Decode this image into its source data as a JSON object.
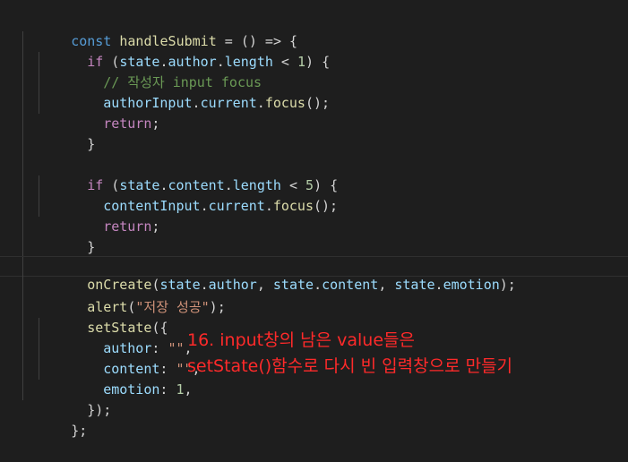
{
  "code": {
    "l1": [
      "const",
      " ",
      "handleSubmit",
      " = () => {"
    ],
    "l2": [
      "if",
      " (",
      "state",
      ".",
      "author",
      ".",
      "length",
      " < ",
      "1",
      ") {"
    ],
    "l3": [
      "// 작성자 input focus"
    ],
    "l4": [
      "authorInput",
      ".",
      "current",
      ".",
      "focus",
      "();"
    ],
    "l5": [
      "return",
      ";"
    ],
    "l6": [
      "}"
    ],
    "l8": [
      "if",
      " (",
      "state",
      ".",
      "content",
      ".",
      "length",
      " < ",
      "5",
      ") {"
    ],
    "l9": [
      "contentInput",
      ".",
      "current",
      ".",
      "focus",
      "();"
    ],
    "l10": [
      "return",
      ";"
    ],
    "l11": [
      "}"
    ],
    "l13": [
      "onCreate",
      "(",
      "state",
      ".",
      "author",
      ", ",
      "state",
      ".",
      "content",
      ", ",
      "state",
      ".",
      "emotion",
      ");"
    ],
    "l14": [
      "alert",
      "(",
      "\"저장 성공\"",
      ");"
    ],
    "l15": [
      "setState",
      "({"
    ],
    "l16": [
      "author",
      ": ",
      "\"\"",
      ","
    ],
    "l17": [
      "content",
      ": ",
      "\"\"",
      ","
    ],
    "l18": [
      "emotion",
      ": ",
      "1",
      ","
    ],
    "l19": [
      "});"
    ],
    "l20": [
      "};"
    ]
  },
  "annotation": {
    "line1": "16. input창의 남은 value들은",
    "line2": "setState()함수로 다시 빈 입력창으로 만들기"
  },
  "colors": {
    "background": "#1e1e1e",
    "keyword": "#569cd6",
    "control": "#c586c0",
    "variable": "#9cdcfe",
    "function": "#dcdcaa",
    "string": "#ce9178",
    "comment": "#6a9955",
    "number": "#b5cea8",
    "annotation": "#ff2a2a"
  }
}
